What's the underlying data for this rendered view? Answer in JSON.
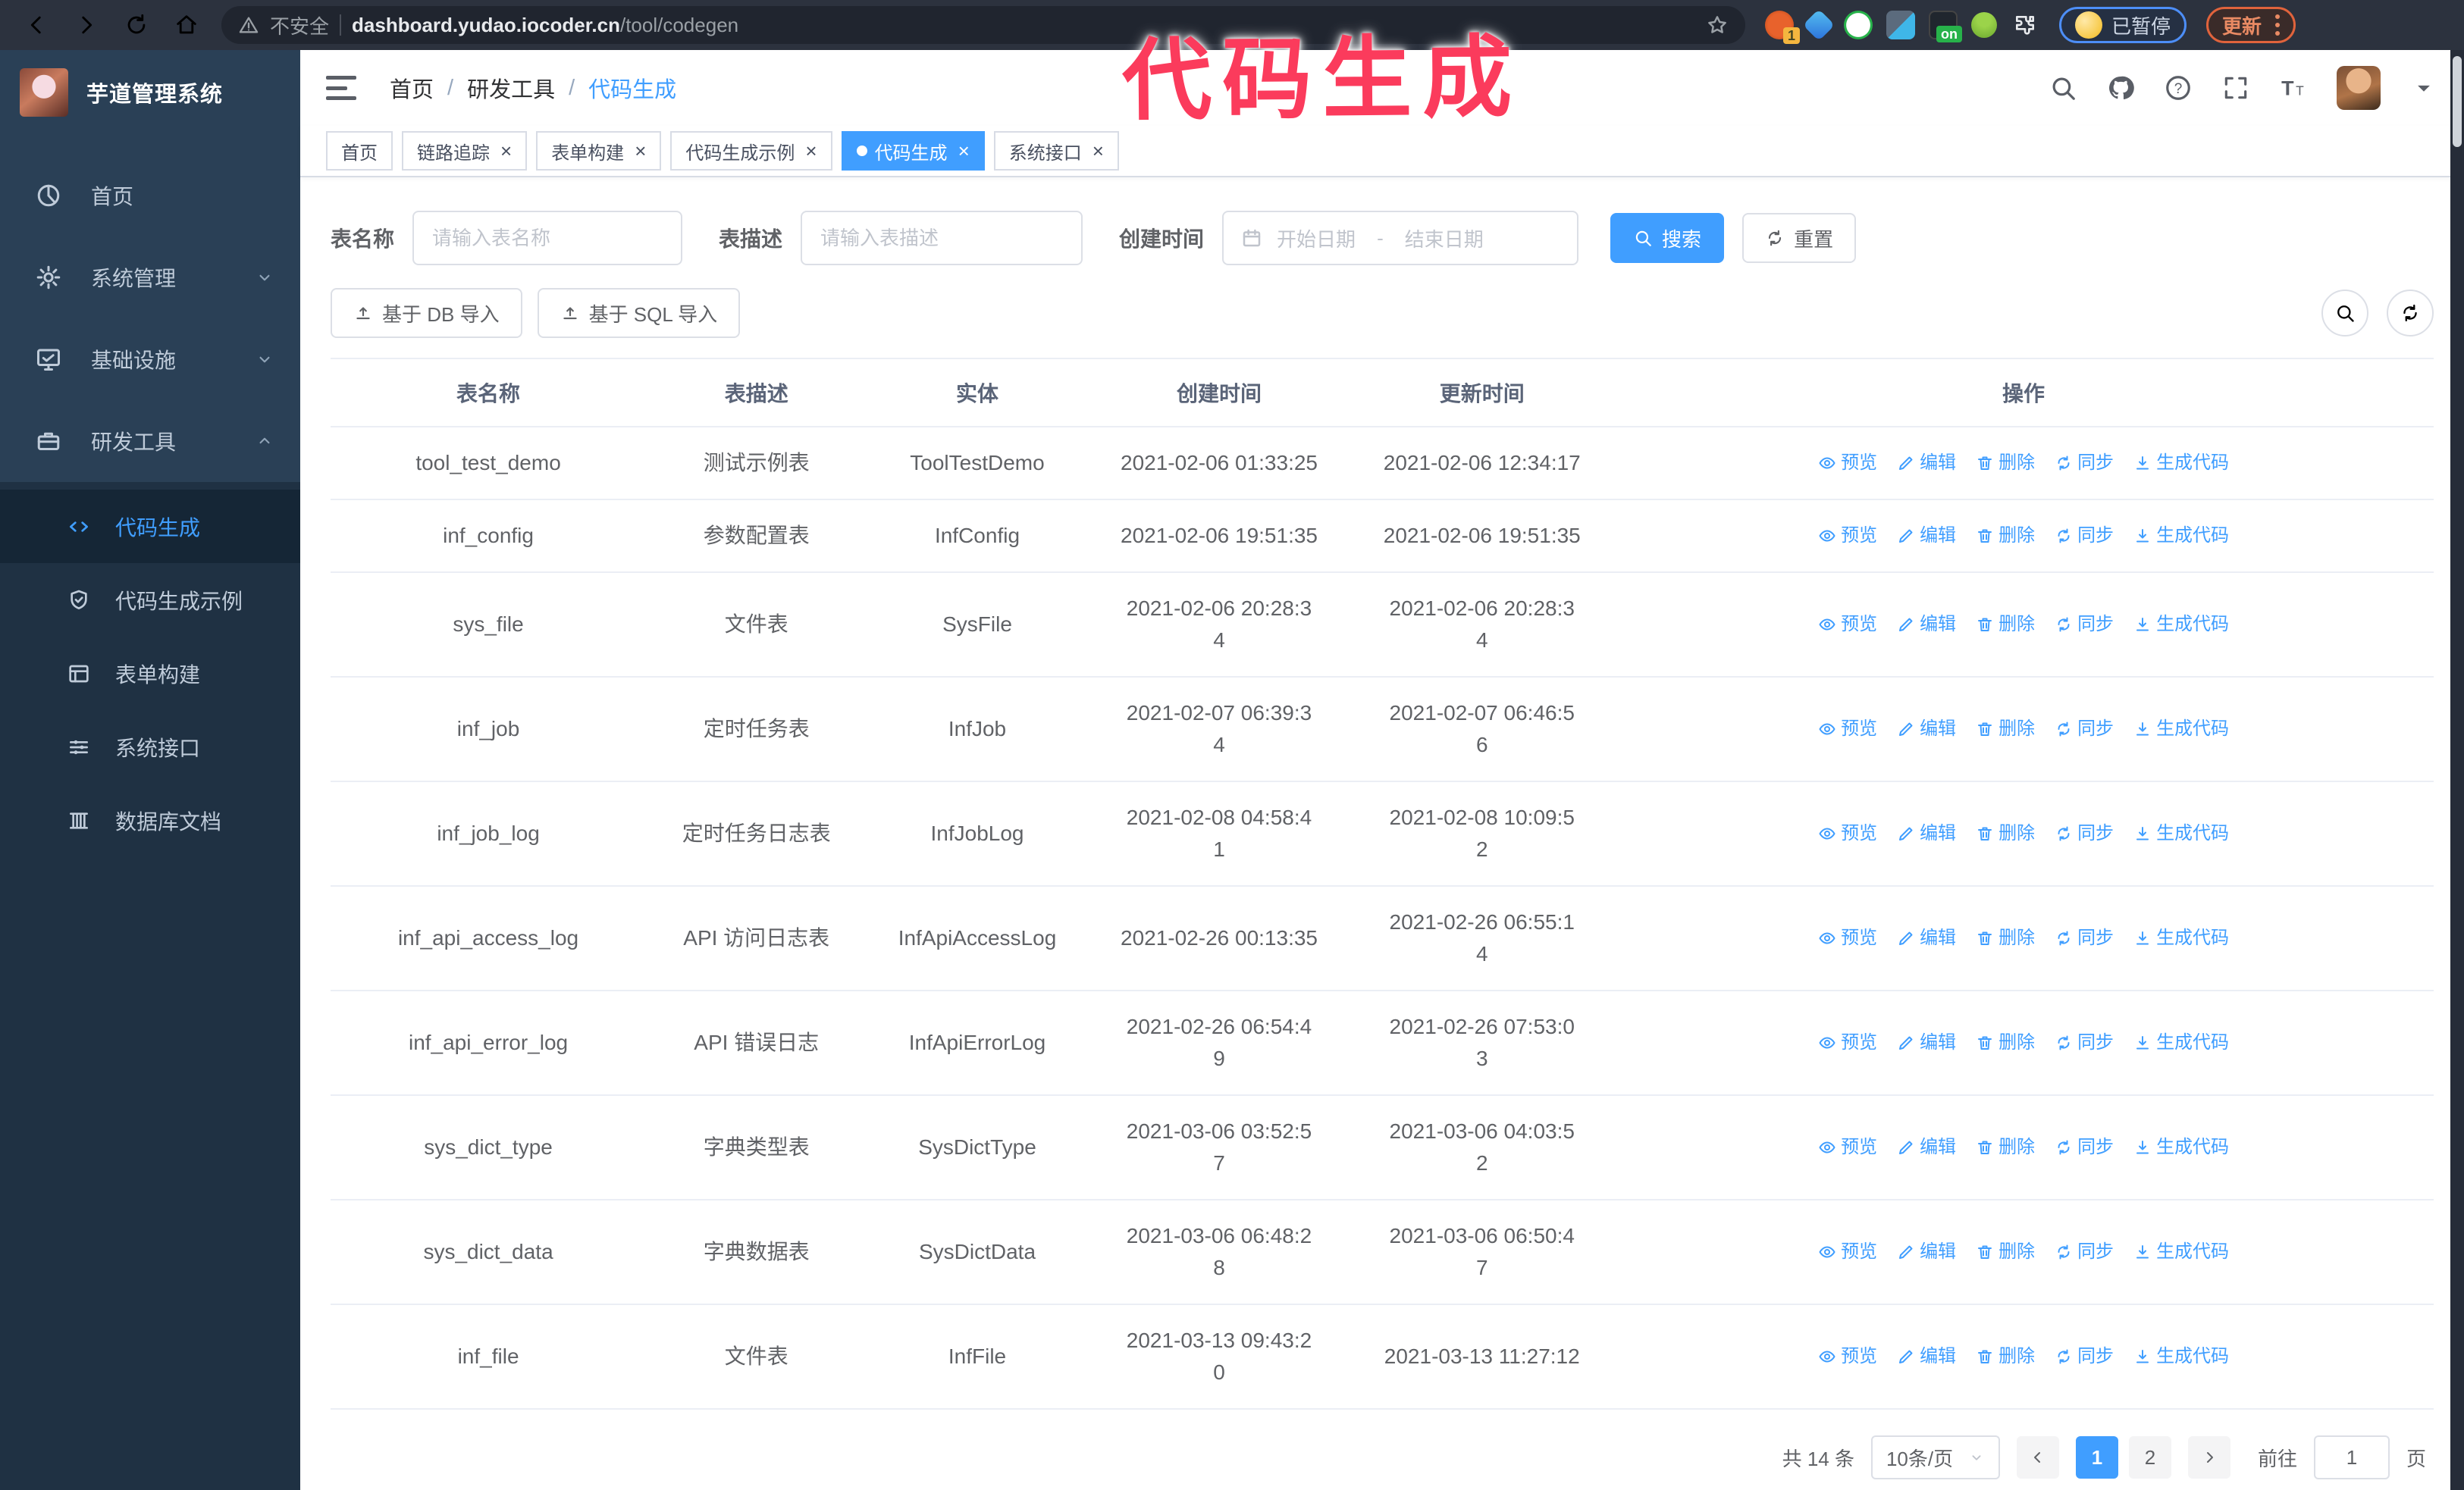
{
  "browser": {
    "security_label": "不安全",
    "url_domain": "dashboard.yudao.iocoder.cn",
    "url_path": "/tool/codegen",
    "extension_badge_count": "1",
    "extension_badge_on": "on",
    "paused_badge": "已暂停",
    "update_button": "更新"
  },
  "annotation": {
    "text": "代码生成",
    "color": "#fb3b5c"
  },
  "sidebar": {
    "title": "芋道管理系统",
    "menu": [
      {
        "label": "首页",
        "icon": "dashboard-icon",
        "chevron": ""
      },
      {
        "label": "系统管理",
        "icon": "gear-icon",
        "chevron": "down"
      },
      {
        "label": "基础设施",
        "icon": "monitor-icon",
        "chevron": "down"
      },
      {
        "label": "研发工具",
        "icon": "toolbox-icon",
        "chevron": "up"
      }
    ],
    "submenu": [
      {
        "label": "代码生成",
        "icon": "code-icon",
        "active": true
      },
      {
        "label": "代码生成示例",
        "icon": "shield-check-icon",
        "active": false
      },
      {
        "label": "表单构建",
        "icon": "form-icon",
        "active": false
      },
      {
        "label": "系统接口",
        "icon": "sliders-icon",
        "active": false
      },
      {
        "label": "数据库文档",
        "icon": "database-icon",
        "active": false
      }
    ]
  },
  "breadcrumb": [
    "首页",
    "研发工具",
    "代码生成"
  ],
  "tabs": [
    {
      "label": "首页",
      "closable": false,
      "active": false
    },
    {
      "label": "链路追踪",
      "closable": true,
      "active": false
    },
    {
      "label": "表单构建",
      "closable": true,
      "active": false
    },
    {
      "label": "代码生成示例",
      "closable": true,
      "active": false
    },
    {
      "label": "代码生成",
      "closable": true,
      "active": true
    },
    {
      "label": "系统接口",
      "closable": true,
      "active": false
    }
  ],
  "filters": {
    "table_name_label": "表名称",
    "table_name_placeholder": "请输入表名称",
    "table_desc_label": "表描述",
    "table_desc_placeholder": "请输入表描述",
    "create_time_label": "创建时间",
    "start_placeholder": "开始日期",
    "range_separator": "-",
    "end_placeholder": "结束日期",
    "search_label": "搜索",
    "reset_label": "重置"
  },
  "toolbar": {
    "import_db_label": "基于 DB 导入",
    "import_sql_label": "基于 SQL 导入"
  },
  "table": {
    "columns": [
      "表名称",
      "表描述",
      "实体",
      "创建时间",
      "更新时间",
      "操作"
    ],
    "actions": [
      {
        "label": "预览",
        "icon": "eye-icon"
      },
      {
        "label": "编辑",
        "icon": "edit-icon"
      },
      {
        "label": "删除",
        "icon": "delete-icon"
      },
      {
        "label": "同步",
        "icon": "sync-icon"
      },
      {
        "label": "生成代码",
        "icon": "download-icon"
      }
    ],
    "rows": [
      {
        "name": "tool_test_demo",
        "desc": "测试示例表",
        "entity": "ToolTestDemo",
        "created": "2021-02-06 01:33:25",
        "updated": "2021-02-06 12:34:17"
      },
      {
        "name": "inf_config",
        "desc": "参数配置表",
        "entity": "InfConfig",
        "created": "2021-02-06 19:51:35",
        "updated": "2021-02-06 19:51:35"
      },
      {
        "name": "sys_file",
        "desc": "文件表",
        "entity": "SysFile",
        "created": "2021-02-06 20:28:3\n4",
        "updated": "2021-02-06 20:28:3\n4"
      },
      {
        "name": "inf_job",
        "desc": "定时任务表",
        "entity": "InfJob",
        "created": "2021-02-07 06:39:3\n4",
        "updated": "2021-02-07 06:46:5\n6"
      },
      {
        "name": "inf_job_log",
        "desc": "定时任务日志表",
        "entity": "InfJobLog",
        "created": "2021-02-08 04:58:4\n1",
        "updated": "2021-02-08 10:09:5\n2"
      },
      {
        "name": "inf_api_access_log",
        "desc": "API 访问日志表",
        "entity": "InfApiAccessLog",
        "created": "2021-02-26 00:13:35",
        "updated": "2021-02-26 06:55:1\n4"
      },
      {
        "name": "inf_api_error_log",
        "desc": "API 错误日志",
        "entity": "InfApiErrorLog",
        "created": "2021-02-26 06:54:4\n9",
        "updated": "2021-02-26 07:53:0\n3"
      },
      {
        "name": "sys_dict_type",
        "desc": "字典类型表",
        "entity": "SysDictType",
        "created": "2021-03-06 03:52:5\n7",
        "updated": "2021-03-06 04:03:5\n2"
      },
      {
        "name": "sys_dict_data",
        "desc": "字典数据表",
        "entity": "SysDictData",
        "created": "2021-03-06 06:48:2\n8",
        "updated": "2021-03-06 06:50:4\n7"
      },
      {
        "name": "inf_file",
        "desc": "文件表",
        "entity": "InfFile",
        "created": "2021-03-13 09:43:2\n0",
        "updated": "2021-03-13 11:27:12"
      }
    ]
  },
  "pagination": {
    "total_label": "共 14 条",
    "page_size_label": "10条/页",
    "pages": [
      "1",
      "2"
    ],
    "active_page": "1",
    "goto_label": "前往",
    "goto_value": "1",
    "page_suffix": "页"
  },
  "colors": {
    "accent": "#409eff",
    "sidebar_bg": "#2a4056",
    "submenu_bg": "#1f3143",
    "active_submenu_bg": "#152636",
    "annotation_pink": "#fb3b5c",
    "browser_bar_bg": "#2c323e",
    "table_border": "#ebeef5"
  }
}
